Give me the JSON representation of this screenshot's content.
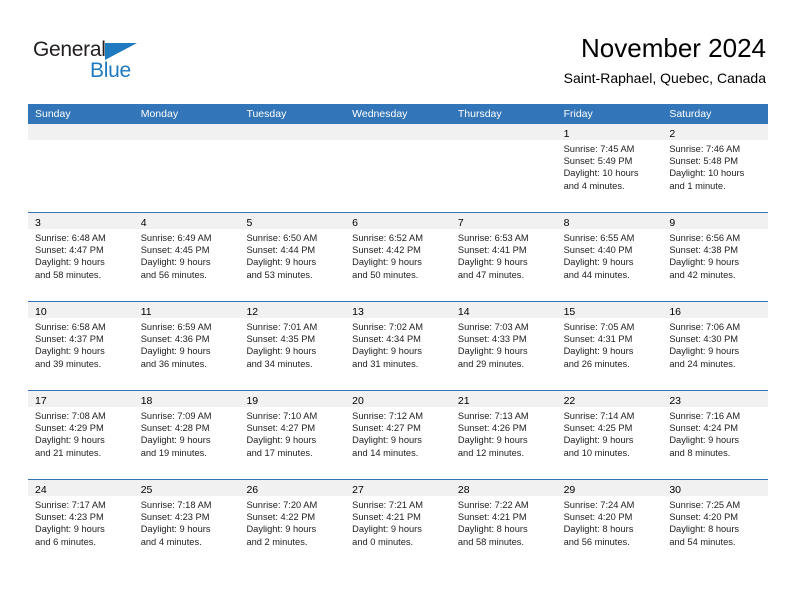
{
  "brand": {
    "name_part1": "General",
    "name_part2": "Blue",
    "accent_color": "#1f7ac0"
  },
  "header": {
    "title": "November 2024",
    "subtitle": "Saint-Raphael, Quebec, Canada"
  },
  "theme": {
    "header_blue": "#3275b8",
    "daynum_bg": "#f1f1f1"
  },
  "weekdays": [
    "Sunday",
    "Monday",
    "Tuesday",
    "Wednesday",
    "Thursday",
    "Friday",
    "Saturday"
  ],
  "weeks": [
    [
      {
        "day": "",
        "lines": []
      },
      {
        "day": "",
        "lines": []
      },
      {
        "day": "",
        "lines": []
      },
      {
        "day": "",
        "lines": []
      },
      {
        "day": "",
        "lines": []
      },
      {
        "day": "1",
        "lines": [
          "Sunrise: 7:45 AM",
          "Sunset: 5:49 PM",
          "Daylight: 10 hours",
          "and 4 minutes."
        ]
      },
      {
        "day": "2",
        "lines": [
          "Sunrise: 7:46 AM",
          "Sunset: 5:48 PM",
          "Daylight: 10 hours",
          "and 1 minute."
        ]
      }
    ],
    [
      {
        "day": "3",
        "lines": [
          "Sunrise: 6:48 AM",
          "Sunset: 4:47 PM",
          "Daylight: 9 hours",
          "and 58 minutes."
        ]
      },
      {
        "day": "4",
        "lines": [
          "Sunrise: 6:49 AM",
          "Sunset: 4:45 PM",
          "Daylight: 9 hours",
          "and 56 minutes."
        ]
      },
      {
        "day": "5",
        "lines": [
          "Sunrise: 6:50 AM",
          "Sunset: 4:44 PM",
          "Daylight: 9 hours",
          "and 53 minutes."
        ]
      },
      {
        "day": "6",
        "lines": [
          "Sunrise: 6:52 AM",
          "Sunset: 4:42 PM",
          "Daylight: 9 hours",
          "and 50 minutes."
        ]
      },
      {
        "day": "7",
        "lines": [
          "Sunrise: 6:53 AM",
          "Sunset: 4:41 PM",
          "Daylight: 9 hours",
          "and 47 minutes."
        ]
      },
      {
        "day": "8",
        "lines": [
          "Sunrise: 6:55 AM",
          "Sunset: 4:40 PM",
          "Daylight: 9 hours",
          "and 44 minutes."
        ]
      },
      {
        "day": "9",
        "lines": [
          "Sunrise: 6:56 AM",
          "Sunset: 4:38 PM",
          "Daylight: 9 hours",
          "and 42 minutes."
        ]
      }
    ],
    [
      {
        "day": "10",
        "lines": [
          "Sunrise: 6:58 AM",
          "Sunset: 4:37 PM",
          "Daylight: 9 hours",
          "and 39 minutes."
        ]
      },
      {
        "day": "11",
        "lines": [
          "Sunrise: 6:59 AM",
          "Sunset: 4:36 PM",
          "Daylight: 9 hours",
          "and 36 minutes."
        ]
      },
      {
        "day": "12",
        "lines": [
          "Sunrise: 7:01 AM",
          "Sunset: 4:35 PM",
          "Daylight: 9 hours",
          "and 34 minutes."
        ]
      },
      {
        "day": "13",
        "lines": [
          "Sunrise: 7:02 AM",
          "Sunset: 4:34 PM",
          "Daylight: 9 hours",
          "and 31 minutes."
        ]
      },
      {
        "day": "14",
        "lines": [
          "Sunrise: 7:03 AM",
          "Sunset: 4:33 PM",
          "Daylight: 9 hours",
          "and 29 minutes."
        ]
      },
      {
        "day": "15",
        "lines": [
          "Sunrise: 7:05 AM",
          "Sunset: 4:31 PM",
          "Daylight: 9 hours",
          "and 26 minutes."
        ]
      },
      {
        "day": "16",
        "lines": [
          "Sunrise: 7:06 AM",
          "Sunset: 4:30 PM",
          "Daylight: 9 hours",
          "and 24 minutes."
        ]
      }
    ],
    [
      {
        "day": "17",
        "lines": [
          "Sunrise: 7:08 AM",
          "Sunset: 4:29 PM",
          "Daylight: 9 hours",
          "and 21 minutes."
        ]
      },
      {
        "day": "18",
        "lines": [
          "Sunrise: 7:09 AM",
          "Sunset: 4:28 PM",
          "Daylight: 9 hours",
          "and 19 minutes."
        ]
      },
      {
        "day": "19",
        "lines": [
          "Sunrise: 7:10 AM",
          "Sunset: 4:27 PM",
          "Daylight: 9 hours",
          "and 17 minutes."
        ]
      },
      {
        "day": "20",
        "lines": [
          "Sunrise: 7:12 AM",
          "Sunset: 4:27 PM",
          "Daylight: 9 hours",
          "and 14 minutes."
        ]
      },
      {
        "day": "21",
        "lines": [
          "Sunrise: 7:13 AM",
          "Sunset: 4:26 PM",
          "Daylight: 9 hours",
          "and 12 minutes."
        ]
      },
      {
        "day": "22",
        "lines": [
          "Sunrise: 7:14 AM",
          "Sunset: 4:25 PM",
          "Daylight: 9 hours",
          "and 10 minutes."
        ]
      },
      {
        "day": "23",
        "lines": [
          "Sunrise: 7:16 AM",
          "Sunset: 4:24 PM",
          "Daylight: 9 hours",
          "and 8 minutes."
        ]
      }
    ],
    [
      {
        "day": "24",
        "lines": [
          "Sunrise: 7:17 AM",
          "Sunset: 4:23 PM",
          "Daylight: 9 hours",
          "and 6 minutes."
        ]
      },
      {
        "day": "25",
        "lines": [
          "Sunrise: 7:18 AM",
          "Sunset: 4:23 PM",
          "Daylight: 9 hours",
          "and 4 minutes."
        ]
      },
      {
        "day": "26",
        "lines": [
          "Sunrise: 7:20 AM",
          "Sunset: 4:22 PM",
          "Daylight: 9 hours",
          "and 2 minutes."
        ]
      },
      {
        "day": "27",
        "lines": [
          "Sunrise: 7:21 AM",
          "Sunset: 4:21 PM",
          "Daylight: 9 hours",
          "and 0 minutes."
        ]
      },
      {
        "day": "28",
        "lines": [
          "Sunrise: 7:22 AM",
          "Sunset: 4:21 PM",
          "Daylight: 8 hours",
          "and 58 minutes."
        ]
      },
      {
        "day": "29",
        "lines": [
          "Sunrise: 7:24 AM",
          "Sunset: 4:20 PM",
          "Daylight: 8 hours",
          "and 56 minutes."
        ]
      },
      {
        "day": "30",
        "lines": [
          "Sunrise: 7:25 AM",
          "Sunset: 4:20 PM",
          "Daylight: 8 hours",
          "and 54 minutes."
        ]
      }
    ]
  ]
}
